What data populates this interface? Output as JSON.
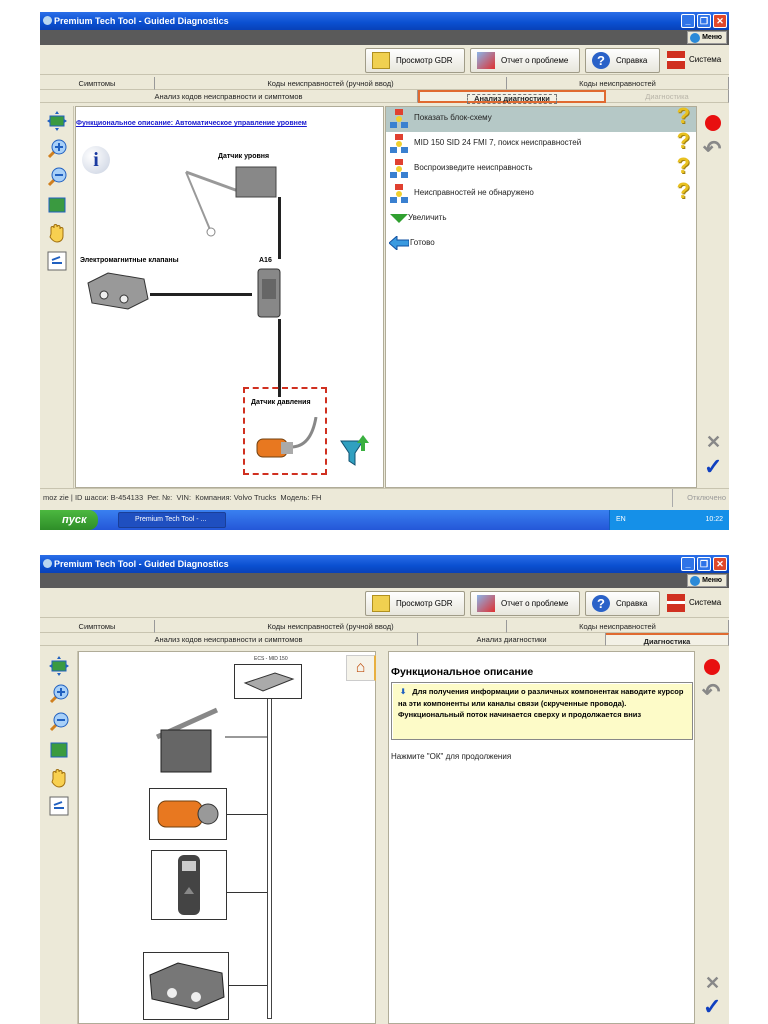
{
  "app_title": "Premium Tech Tool - Guided Diagnostics",
  "window_buttons": {
    "minimize": "_",
    "maximize": "❐",
    "close": "✕"
  },
  "menu_label": "Меню",
  "toolbar": {
    "gdr": "Просмотр GDR",
    "report": "Отчет о проблеме",
    "help": "Справка",
    "system": "Система"
  },
  "tabs_row1": [
    "Симптомы",
    "Коды неисправностей (ручной ввод)",
    "Коды неисправностей"
  ],
  "tabs_row2": [
    "Анализ кодов неисправности и симптомов",
    "Анализ диагностики",
    "Диагностика"
  ],
  "screen1": {
    "diagram_link": "Функциональное описание: Автоматическое управление уровнем",
    "labels": {
      "level_sensor": "Датчик уровня",
      "solenoid_valves": "Электромагнитные клапаны",
      "ecu": "A16",
      "pressure_sensor": "Датчик давления"
    },
    "list": [
      {
        "label": "Показать блок-схему",
        "icon": "network-icon",
        "help": "?"
      },
      {
        "label": "MID 150 SID 24 FMI 7, поиск неисправностей",
        "icon": "network-icon",
        "help": "?"
      },
      {
        "label": "Воспроизведите неисправность",
        "icon": "network-icon",
        "help": "?"
      },
      {
        "label": "Неисправностей не обнаружено",
        "icon": "network-icon",
        "help": "?"
      },
      {
        "label": "Увеличить",
        "icon": "triangle-down-icon"
      },
      {
        "label": "Готово",
        "icon": "arrow-left-icon"
      }
    ],
    "status": {
      "user": "moz zie",
      "chassis": "ID шасси: B-454133",
      "reg": "Рег. №:",
      "vin": "VIN:",
      "company": "Компания: Volvo Trucks",
      "model": "Модель: FH",
      "connection": "Отключено"
    },
    "taskbar": {
      "start": "пуск",
      "task": "Premium Tech Tool - ...",
      "lang": "EN",
      "time": "10:22"
    }
  },
  "screen2": {
    "ecu_label": "ECS - MID 150",
    "heading": "Функциональное описание",
    "info": "Для получения информации о различных компонентак наводите курсор на эти компоненты или каналы связи (скрученные провода). Функциональный поток начинается сверху и продолжается вниз",
    "prompt": "Нажмите \"ОК\" для продолжения"
  },
  "colors": {
    "accent": "#e06a30",
    "title_bar": "#0a4fd0",
    "selected_row": "#b5c8c6",
    "info_bg": "#fdfbc8"
  }
}
